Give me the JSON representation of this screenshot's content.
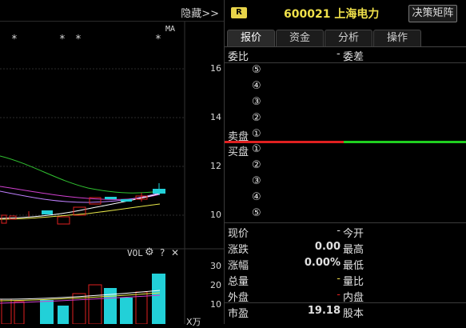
{
  "chart": {
    "hide_label": "隐藏>>",
    "ma_label": "MA",
    "stars": [
      "*",
      "*",
      "*",
      "*"
    ],
    "price_ticks": [
      "16",
      "14",
      "12",
      "10"
    ],
    "vol_label": "VOL",
    "vol_ticks": [
      "30",
      "20",
      "10"
    ],
    "vol_unit": "X万",
    "help_label": "?",
    "close_label": "✕"
  },
  "header": {
    "badge": "R",
    "title": "600021 上海电力",
    "matrix_button": "决策矩阵"
  },
  "tabs": [
    {
      "label": "报价",
      "active": true
    },
    {
      "label": "资金",
      "active": false
    },
    {
      "label": "分析",
      "active": false
    },
    {
      "label": "操作",
      "active": false
    }
  ],
  "orderbook": {
    "weibi_label": "委比",
    "weibi_value": "-",
    "weicha_label": "委差",
    "sell_label": "卖盘",
    "buy_label": "买盘",
    "sell_levels": [
      "⑤",
      "④",
      "③",
      "②",
      "①"
    ],
    "buy_levels": [
      "①",
      "②",
      "③",
      "④",
      "⑤"
    ]
  },
  "stats": {
    "rows": [
      {
        "l1": "现价",
        "v1": "-",
        "l2": "今开"
      },
      {
        "l1": "涨跌",
        "v1": "0.00",
        "l2": "最高"
      },
      {
        "l1": "涨幅",
        "v1": "0.00%",
        "l2": "最低"
      },
      {
        "l1": "总量",
        "v1": "-",
        "l2": "量比"
      },
      {
        "l1": "外盘",
        "v1": "-",
        "l2": "内盘"
      },
      {
        "l1": "市盈",
        "v1": "19.18",
        "l2": "股本"
      }
    ]
  },
  "colors": {
    "up": "#e02020",
    "down": "#22d0d8",
    "ma5": "#ffffff",
    "ma10": "#e8e84a",
    "ma20": "#d040d0",
    "ma60": "#30c030",
    "bar_red": "#e02020",
    "bar_green": "#20d020"
  }
}
